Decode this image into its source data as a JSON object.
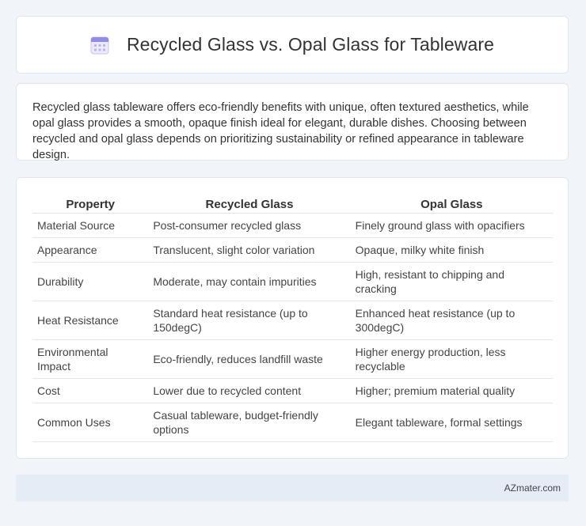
{
  "header": {
    "title": "Recycled Glass vs. Opal Glass for Tableware",
    "icon": "calendar-icon"
  },
  "intro": {
    "text": "Recycled glass tableware offers eco-friendly benefits with unique, often textured aesthetics, while opal glass provides a smooth, opaque finish ideal for elegant, durable dishes. Choosing between recycled and opal glass depends on prioritizing sustainability or refined appearance in tableware design."
  },
  "table": {
    "headers": [
      "Property",
      "Recycled Glass",
      "Opal Glass"
    ],
    "rows": [
      [
        "Material Source",
        "Post-consumer recycled glass",
        "Finely ground glass with opacifiers"
      ],
      [
        "Appearance",
        "Translucent, slight color variation",
        "Opaque, milky white finish"
      ],
      [
        "Durability",
        "Moderate, may contain impurities",
        "High, resistant to chipping and cracking"
      ],
      [
        "Heat Resistance",
        "Standard heat resistance (up to 150degC)",
        "Enhanced heat resistance (up to 300degC)"
      ],
      [
        "Environmental Impact",
        "Eco-friendly, reduces landfill waste",
        "Higher energy production, less recyclable"
      ],
      [
        "Cost",
        "Lower due to recycled content",
        "Higher; premium material quality"
      ],
      [
        "Common Uses",
        "Casual tableware, budget-friendly options",
        "Elegant tableware, formal settings"
      ]
    ]
  },
  "footer": {
    "brand": "AZmater.com"
  },
  "colors": {
    "background": "#f1f4f9",
    "card": "#ffffff",
    "footer": "#e6ecf6",
    "icon_accent": "#8f8cf0"
  }
}
